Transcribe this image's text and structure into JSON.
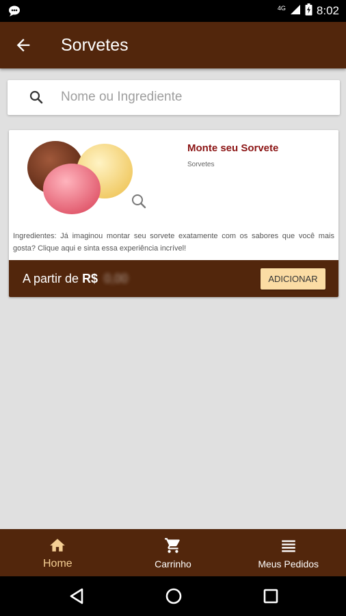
{
  "status_bar": {
    "network": "4G",
    "battery_icon": "battery-charging-icon",
    "time": "8:02"
  },
  "app_bar": {
    "title": "Sorvetes",
    "back_icon": "arrow-left-icon"
  },
  "search": {
    "placeholder": "Nome ou Ingrediente",
    "value": ""
  },
  "products": [
    {
      "name": "Monte seu Sorvete",
      "category": "Sorvetes",
      "description": "Ingredientes: Já imaginou montar seu sorvete exatamente com os sabores que você mais gosta? Clique aqui e sinta essa experiência incrível!",
      "price_prefix": "A partir de",
      "currency": "R$",
      "price_value": "0,00",
      "add_label": "ADICIONAR"
    }
  ],
  "bottom_nav": [
    {
      "label": "Home",
      "icon": "home-icon",
      "active": true
    },
    {
      "label": "Carrinho",
      "icon": "cart-icon",
      "active": false
    },
    {
      "label": "Meus Pedidos",
      "icon": "list-icon",
      "active": false
    }
  ],
  "colors": {
    "primary": "#52260c",
    "accent": "#f5cf94",
    "button_bg": "#fbdca4",
    "product_name": "#8b1414",
    "background": "#e0e0e0"
  }
}
